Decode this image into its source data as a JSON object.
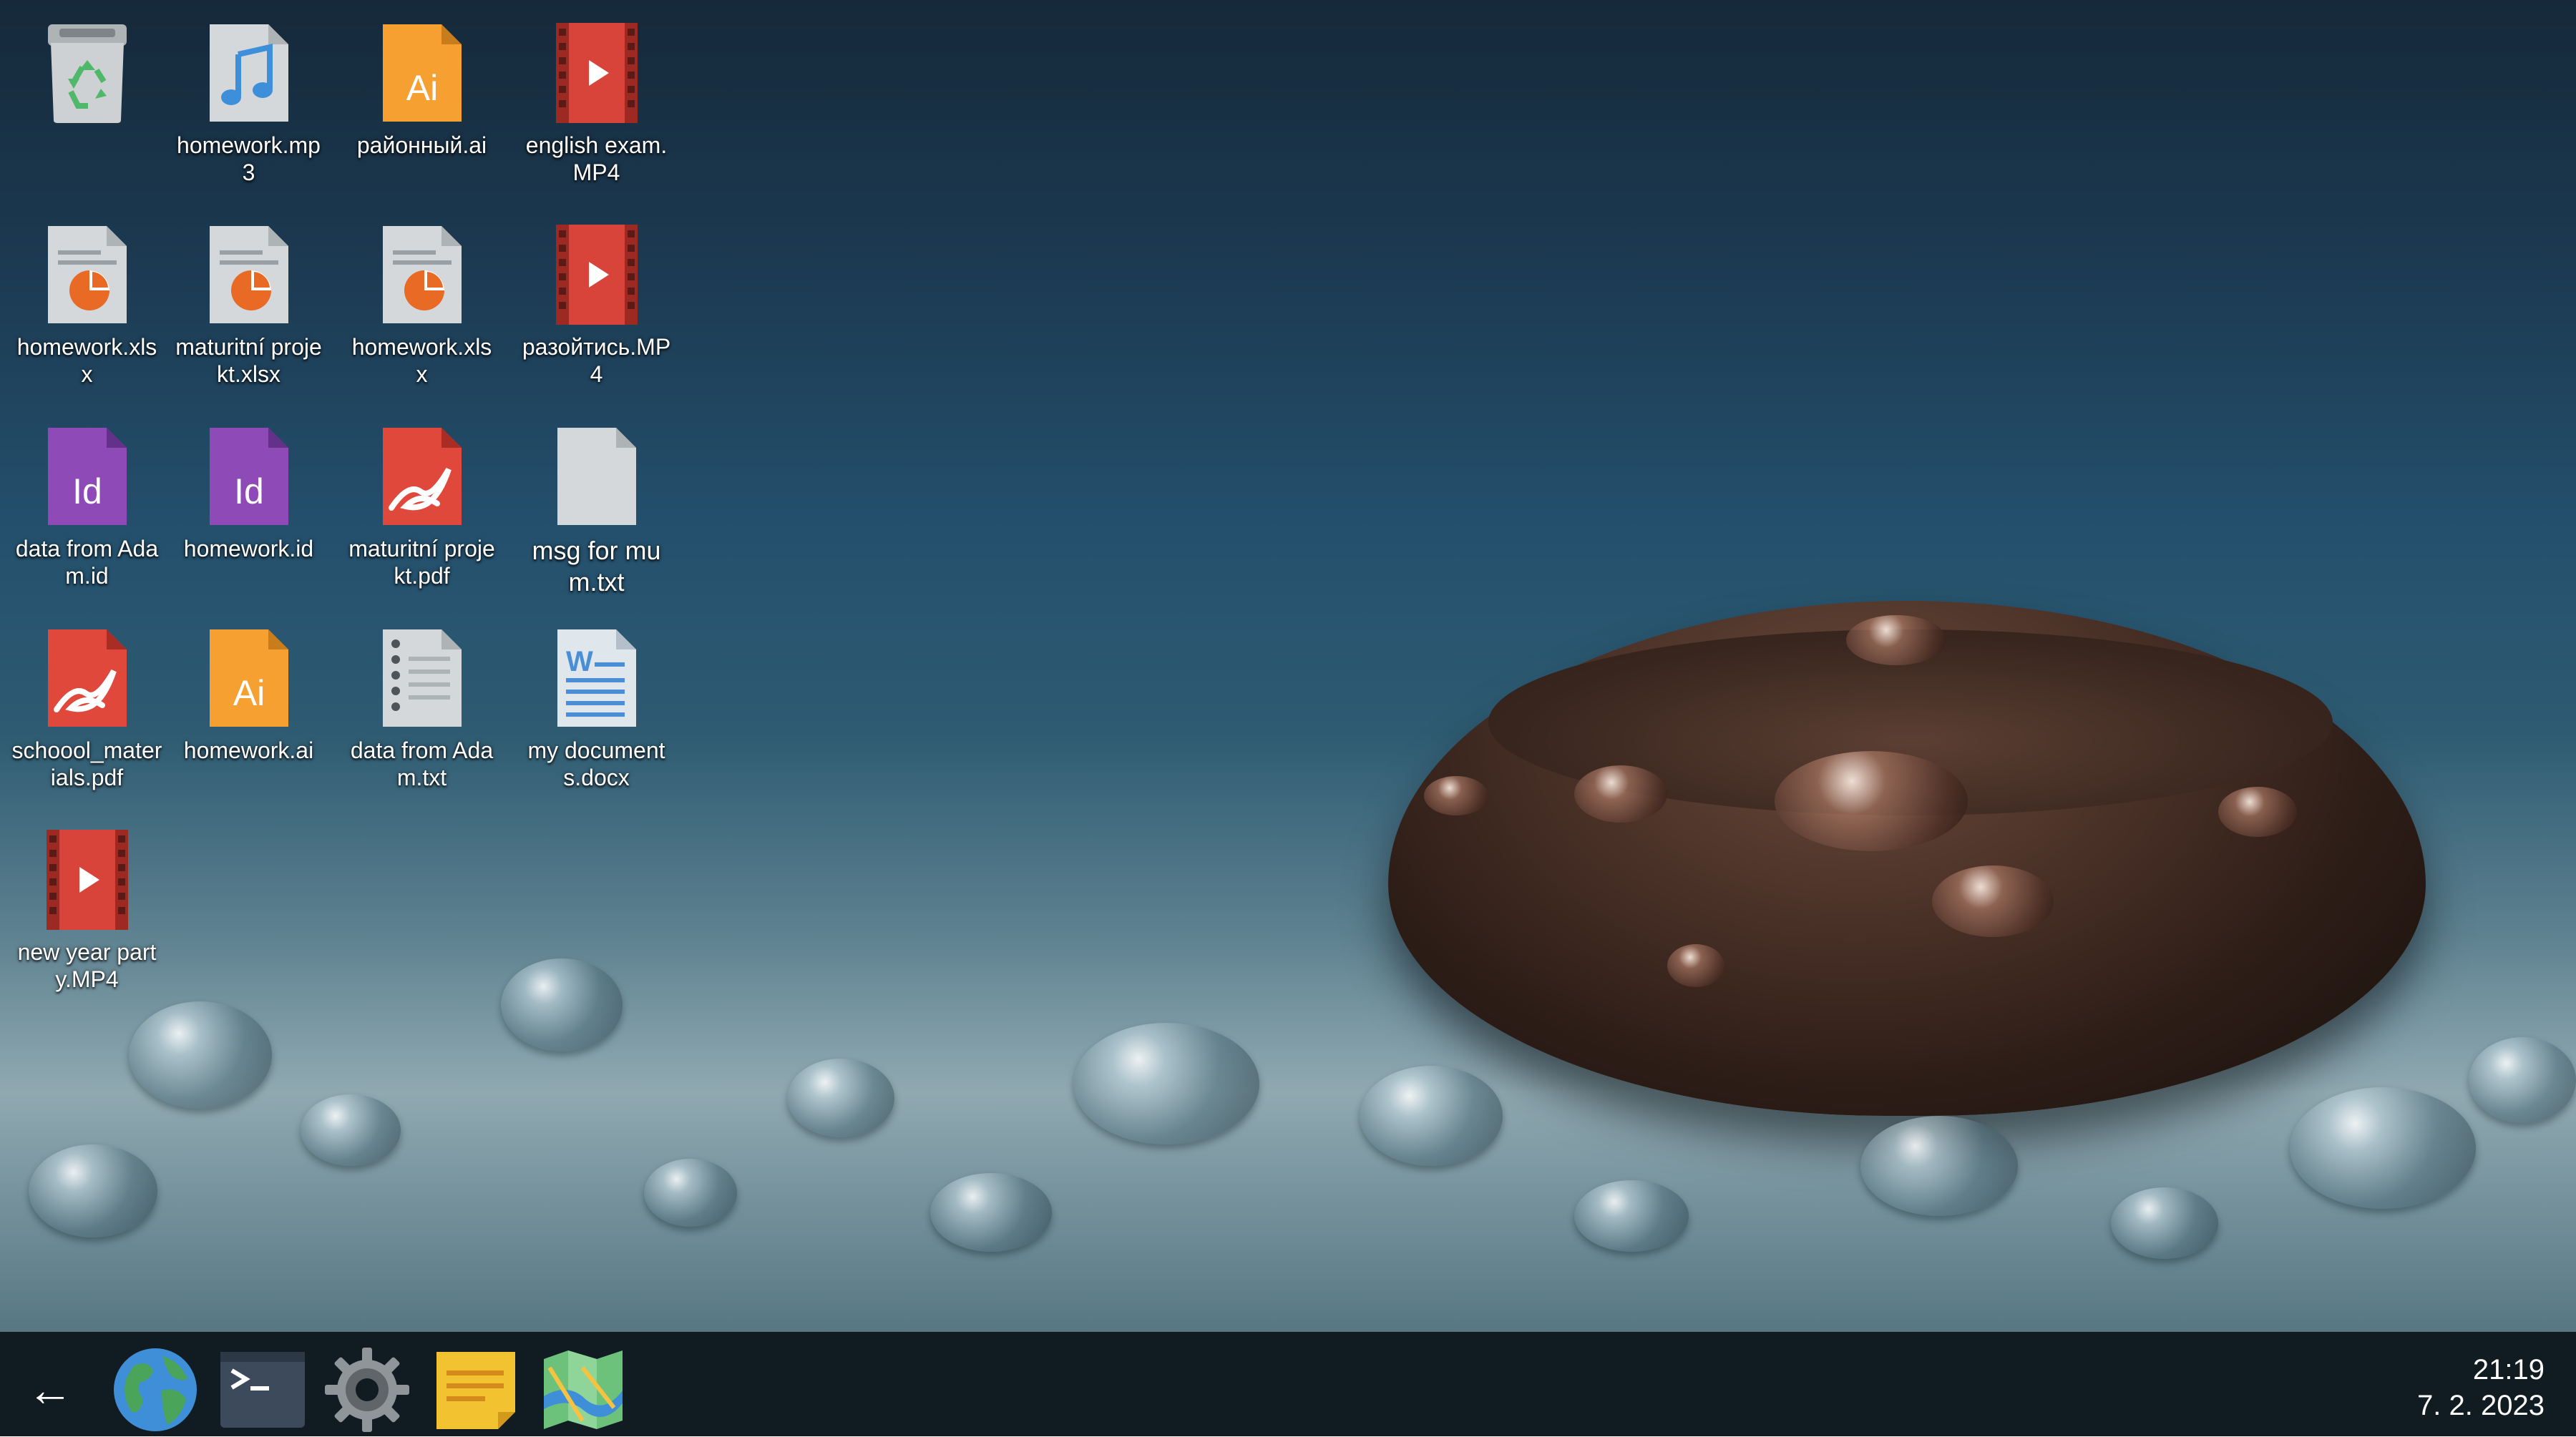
{
  "desktop": {
    "icons": [
      {
        "label": "",
        "icon": "trash-recycle-icon"
      },
      {
        "label": "homework.mp3",
        "icon": "audio-file-icon"
      },
      {
        "label": "районный.ai",
        "icon": "illustrator-file-icon"
      },
      {
        "label": "english exam.MP4",
        "icon": "video-file-icon"
      },
      {
        "label": "homework.xlsx",
        "icon": "spreadsheet-chart-icon"
      },
      {
        "label": "maturitní projekt.xlsx",
        "icon": "spreadsheet-chart-icon"
      },
      {
        "label": "homework.xlsx",
        "icon": "spreadsheet-chart-icon"
      },
      {
        "label": "разойтись.MP4",
        "icon": "video-file-icon"
      },
      {
        "label": "data from Adam.id",
        "icon": "indesign-file-icon"
      },
      {
        "label": "homework.id",
        "icon": "indesign-file-icon"
      },
      {
        "label": "maturitní projekt.pdf",
        "icon": "pdf-file-icon"
      },
      {
        "label": "msg for mum.txt",
        "icon": "blank-file-icon"
      },
      {
        "label": "schoool_materials.pdf",
        "icon": "pdf-file-icon"
      },
      {
        "label": "homework.ai",
        "icon": "illustrator-file-icon"
      },
      {
        "label": "data from Adam.txt",
        "icon": "notepad-file-icon"
      },
      {
        "label": "my documents.docx",
        "icon": "word-document-icon"
      },
      {
        "label": "new year party.MP4",
        "icon": "video-file-icon"
      }
    ]
  },
  "taskbar": {
    "back_label": "←",
    "apps": [
      {
        "name": "browser",
        "icon": "globe-icon"
      },
      {
        "name": "terminal",
        "icon": "terminal-icon",
        "prompt": ">_"
      },
      {
        "name": "settings",
        "icon": "gear-icon"
      },
      {
        "name": "notes",
        "icon": "sticky-note-icon"
      },
      {
        "name": "maps",
        "icon": "map-icon"
      }
    ],
    "clock": {
      "time": "21:19",
      "date": "7. 2. 2023"
    }
  },
  "colors": {
    "taskbar_bg": "#101b22",
    "video_red": "#d9443a",
    "ai_orange": "#f5a030",
    "indesign_purple": "#8e4bb8",
    "pdf_red": "#e0483c",
    "doc_gray": "#d4d8db",
    "word_blue": "#4a8fd6"
  }
}
